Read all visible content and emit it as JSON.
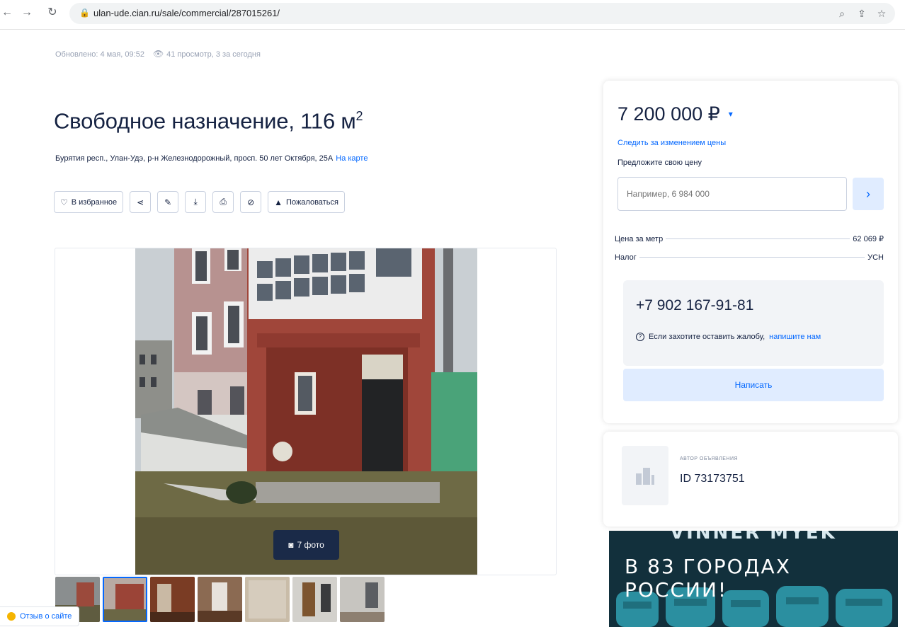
{
  "browser": {
    "url": "ulan-ude.cian.ru/sale/commercial/287015261/"
  },
  "meta": {
    "updated": "Обновлено: 4 мая, 09:52",
    "views": "41 просмотр, 3 за сегодня"
  },
  "listing": {
    "title": "Свободное назначение, 116 м",
    "title_sup": "2",
    "address": "Бурятия респ., Улан-Удэ, р-н Железнодорожный, просп. 50 лет Октября, 25А",
    "map_link": "На карте"
  },
  "actions": {
    "favorite": "В избранное",
    "complain": "Пожаловаться"
  },
  "gallery": {
    "photo_count": "7 фото",
    "thumbnails": 7
  },
  "feedback": {
    "label": "Отзыв о сайте"
  },
  "price_card": {
    "price": "7 200 000 ₽",
    "follow_price": "Следить за изменением цены",
    "offer_label": "Предложите свою цену",
    "offer_placeholder": "Например, 6 984 000",
    "price_per_meter_label": "Цена за метр",
    "price_per_meter_value": "62 069 ₽",
    "tax_label": "Налог",
    "tax_value": "УСН",
    "phone": "+7 902 167-91-81",
    "complain_text": "Если захотите оставить жалобу,",
    "complain_link": "напишите нам",
    "write_button": "Написать"
  },
  "author": {
    "label": "АВТОР ОБЪЯВЛЕНИЯ",
    "id": "ID 73173751"
  },
  "ad": {
    "top_text": "VINNER MYEK",
    "text": "В 83 ГОРОДАХ РОССИИ!"
  },
  "colors": {
    "link": "#0468ff",
    "text": "#152242",
    "button_bg": "#e0ecff"
  }
}
